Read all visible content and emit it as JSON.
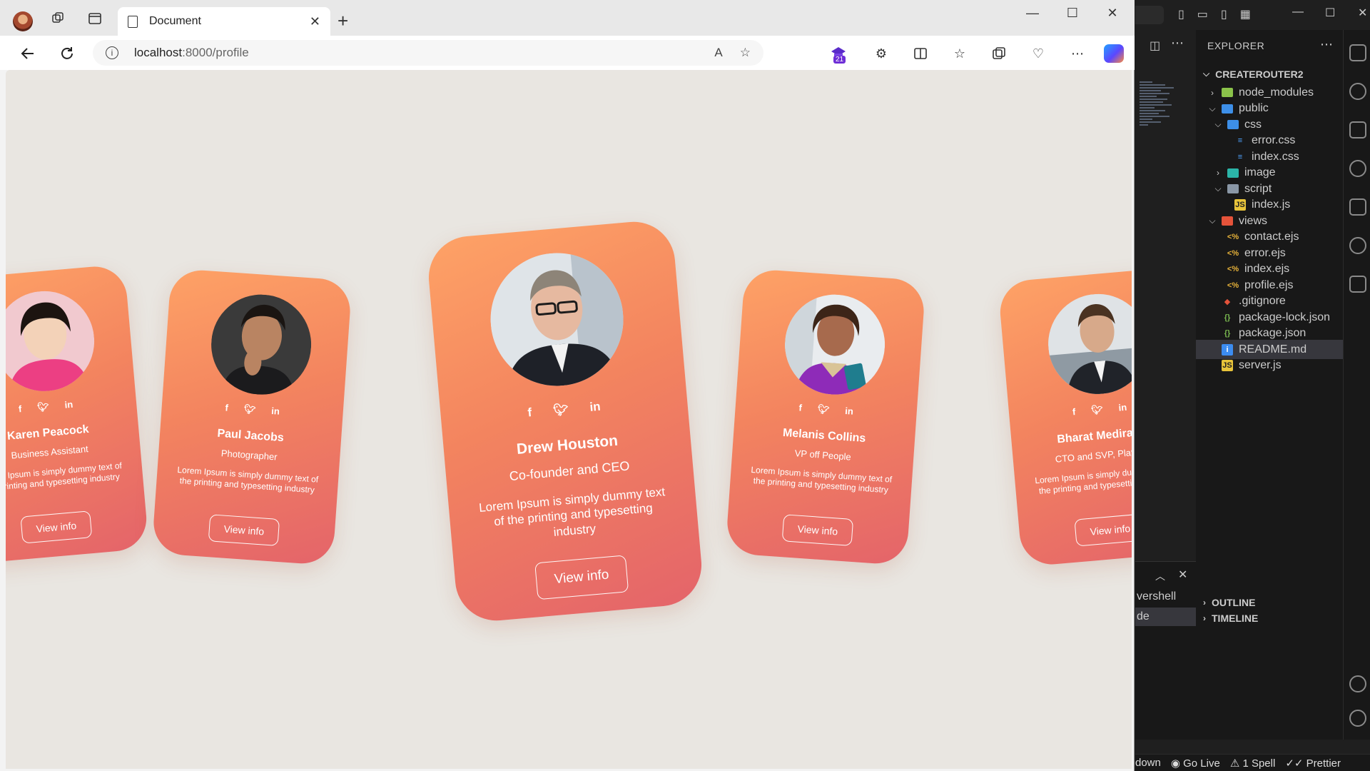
{
  "browser": {
    "tab_title": "Document",
    "url_host": "localhost",
    "url_path": ":8000/profile",
    "read_aloud_label": "A",
    "extension_badge": "21"
  },
  "cards": [
    {
      "name": "Karen Peacock",
      "role": "Business Assistant",
      "desc": "Lorem Ipsum is simply dummy text of the printing and typesetting industry",
      "button": "View info"
    },
    {
      "name": "Paul Jacobs",
      "role": "Photographer",
      "desc": "Lorem Ipsum is simply dummy text of the printing and typesetting industry",
      "button": "View info"
    },
    {
      "name": "Drew Houston",
      "role": "Co-founder and CEO",
      "desc": "Lorem Ipsum is simply dummy text of the printing and typesetting industry",
      "button": "View info"
    },
    {
      "name": "Melanis Collins",
      "role": "VP off People",
      "desc": "Lorem Ipsum is simply dummy text of the printing and typesetting industry",
      "button": "View info"
    },
    {
      "name": "Bharat Mediratta",
      "role": "CTO and SVP, Platform",
      "desc": "Lorem Ipsum is simply dummy text of the printing and typesetting industry",
      "button": "View info"
    }
  ],
  "social_icons": {
    "facebook": "f",
    "twitter": "t",
    "linkedin": "in"
  },
  "vscode": {
    "explorer_title": "EXPLORER",
    "project": "CREATEROUTER2",
    "tree": [
      {
        "label": "node_modules",
        "kind": "folder",
        "open": false,
        "depth": 1
      },
      {
        "label": "public",
        "kind": "folder",
        "open": true,
        "depth": 1
      },
      {
        "label": "css",
        "kind": "folder",
        "open": true,
        "depth": 2
      },
      {
        "label": "error.css",
        "kind": "css",
        "depth": 3
      },
      {
        "label": "index.css",
        "kind": "css",
        "depth": 3
      },
      {
        "label": "image",
        "kind": "folder",
        "open": false,
        "depth": 2
      },
      {
        "label": "script",
        "kind": "folder",
        "open": true,
        "depth": 2
      },
      {
        "label": "index.js",
        "kind": "js",
        "depth": 3
      },
      {
        "label": "views",
        "kind": "folder",
        "open": true,
        "depth": 1
      },
      {
        "label": "contact.ejs",
        "kind": "ejs",
        "depth": 2
      },
      {
        "label": "error.ejs",
        "kind": "ejs",
        "depth": 2
      },
      {
        "label": "index.ejs",
        "kind": "ejs",
        "depth": 2
      },
      {
        "label": "profile.ejs",
        "kind": "ejs",
        "depth": 2
      },
      {
        "label": ".gitignore",
        "kind": "git",
        "depth": 1
      },
      {
        "label": "package-lock.json",
        "kind": "json",
        "depth": 1
      },
      {
        "label": "package.json",
        "kind": "json",
        "depth": 1
      },
      {
        "label": "README.md",
        "kind": "info",
        "depth": 1,
        "selected": true
      },
      {
        "label": "server.js",
        "kind": "js",
        "depth": 1
      }
    ],
    "outline": "OUTLINE",
    "timeline": "TIMELINE",
    "terminal_lines": [
      "vershell",
      "de"
    ],
    "status": {
      "left": "down",
      "golive": "Go Live",
      "spell": "1 Spell",
      "prettier": "Prettier"
    }
  },
  "colors": {
    "card_top": "#fea266",
    "card_bottom": "#e4646a",
    "page_bg": "#e9e6e1"
  }
}
